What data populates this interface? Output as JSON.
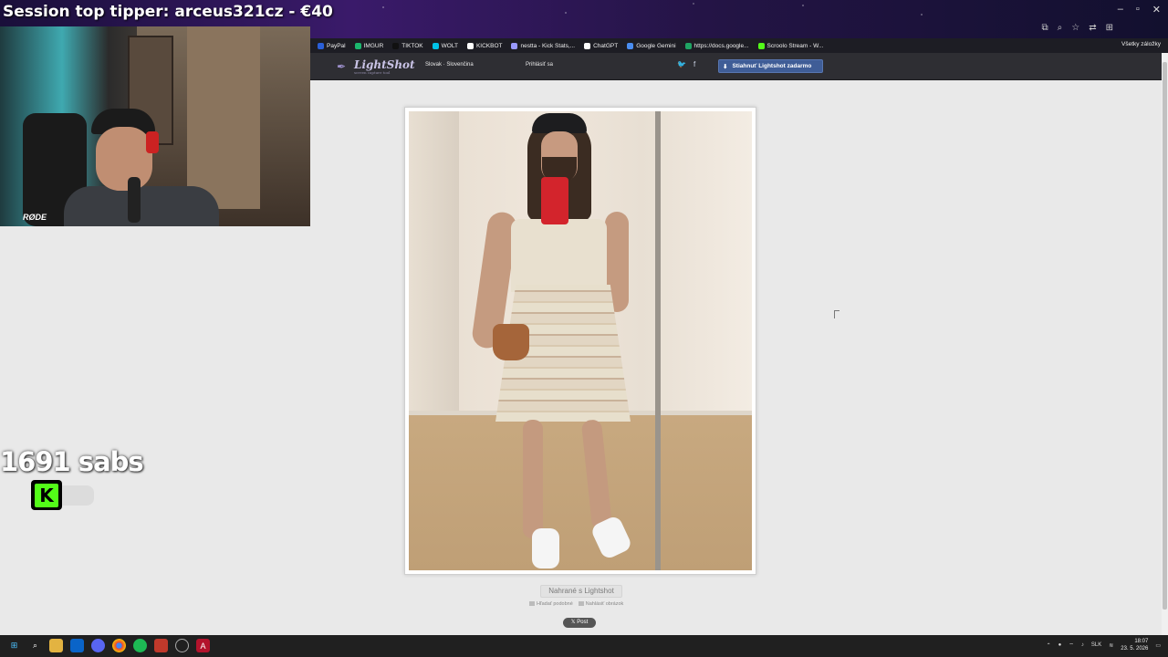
{
  "overlay": {
    "top_tipper": "Session top tipper: arceus321cz - €40",
    "subs": "1691 sabs",
    "kick_letter": "K",
    "webcam_brand": "RØDE"
  },
  "bookmarks": [
    {
      "label": "PayPal",
      "color": "#2a5fd8"
    },
    {
      "label": "IMGUR",
      "color": "#1bb76e"
    },
    {
      "label": "TIKTOK",
      "color": "#111111"
    },
    {
      "label": "WOLT",
      "color": "#00c2e8"
    },
    {
      "label": "KICKBOT",
      "color": "#ffffff"
    },
    {
      "label": "nestta - Kick Stats,...",
      "color": "#9999ff"
    },
    {
      "label": "ChatGPT",
      "color": "#ffffff"
    },
    {
      "label": "Google Gemini",
      "color": "#4a8df0"
    },
    {
      "label": "https://docs.google...",
      "color": "#1fa463"
    },
    {
      "label": "Scroolo Stream - W...",
      "color": "#53fc18"
    }
  ],
  "bookmarks_all": "Všetky záložky",
  "lightshot": {
    "logo": "LightShot",
    "tagline": "screen capture tool",
    "language": "Slovak · Slovenčina",
    "login": "Prihlásiť sa",
    "download": "Stiahnuť Lightshot zadarmo",
    "uploaded_with": "Nahrané s Lightshot",
    "search_similar": "Hľadať podobné",
    "report": "Nahlásiť obrázok",
    "post": "𝕏 Post"
  },
  "taskbar": {
    "language": "SLK",
    "time": "18:07",
    "date": "23. 5. 2026"
  }
}
